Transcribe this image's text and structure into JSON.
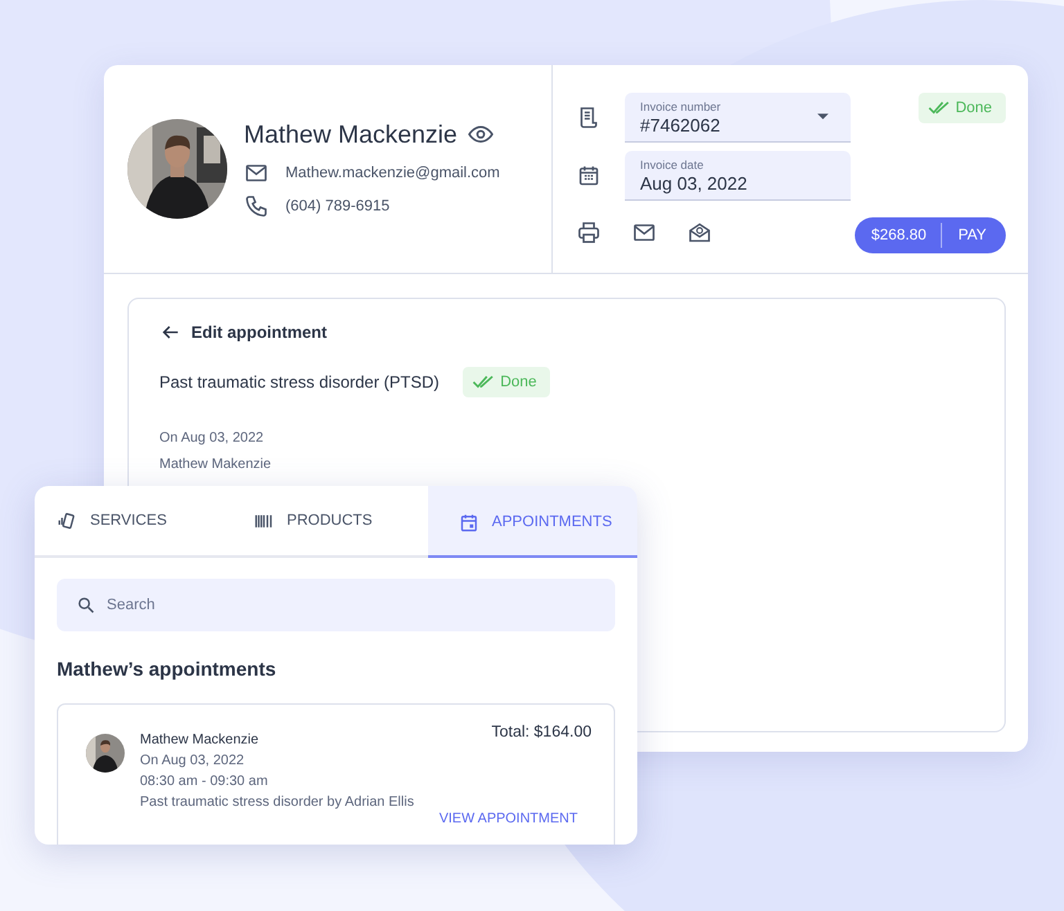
{
  "customer": {
    "name": "Mathew Mackenzie",
    "email": "Mathew.mackenzie@gmail.com",
    "phone": "(604) 789-6915"
  },
  "invoice": {
    "number_label": "Invoice number",
    "number": "#7462062",
    "date_label": "Invoice date",
    "date": "Aug 03, 2022",
    "status": "Done",
    "amount": "$268.80",
    "pay": "PAY"
  },
  "appointment": {
    "back_title": "Edit appointment",
    "service": "Past traumatic stress disorder (PTSD)",
    "status": "Done",
    "date": "On Aug 03, 2022",
    "client": "Mathew Makenzie"
  },
  "panel": {
    "tabs": [
      {
        "kind": "services",
        "label": "SERVICES",
        "selected": false
      },
      {
        "kind": "products",
        "label": "PRODUCTS",
        "selected": false
      },
      {
        "kind": "appointments",
        "label": "APPOINTMENTS",
        "selected": true
      }
    ],
    "search": {
      "placeholder": "Search"
    },
    "heading": "Mathew’s appointments",
    "appointments": [
      {
        "name": "Mathew Mackenzie",
        "date": "On Aug 03, 2022",
        "time": "08:30 am - 09:30 am",
        "description": "Past traumatic stress disorder by Adrian Ellis",
        "total": "Total: $164.00",
        "action": "VIEW APPOINTMENT"
      }
    ]
  }
}
